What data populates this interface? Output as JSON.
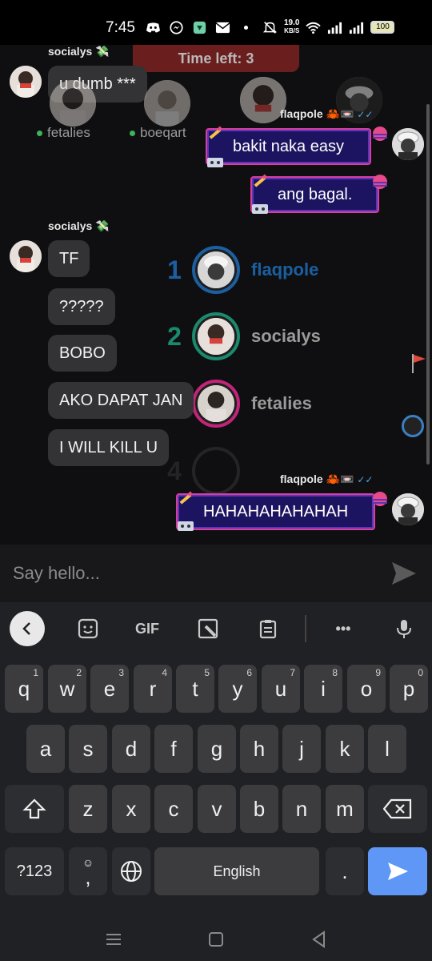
{
  "status_bar": {
    "time": "7:45",
    "net_speed_value": "19.0",
    "net_speed_unit": "KB/S",
    "battery": "100",
    "icons": [
      "discord-icon",
      "messenger-icon",
      "app-icon",
      "mail-icon",
      "dot-icon",
      "mute-icon",
      "wifi-icon",
      "signal-icon",
      "signal-icon-2",
      "battery-icon"
    ]
  },
  "chat": {
    "timer_text": "Time left: 3",
    "messages": [
      {
        "sender": "socialys 💸",
        "text": "u dumb ***"
      },
      {
        "sender": "flaqpole 🦀📼",
        "text": "bakit naka easy"
      },
      {
        "text": "ang bagal."
      },
      {
        "sender": "socialys 💸",
        "text": "TF"
      },
      {
        "text": "?????"
      },
      {
        "text": "BOBO"
      },
      {
        "text": "AKO DAPAT JAN"
      },
      {
        "text": "I WILL KILL U"
      },
      {
        "sender": "flaqpole 🦀📼",
        "text": "HAHAHAHAHAHAH"
      }
    ],
    "online_players": [
      {
        "name": "fetalies"
      },
      {
        "name": "boeqart"
      }
    ],
    "leaderboard": [
      {
        "rank": "1",
        "name": "flaqpole",
        "color": "#1b5fa0"
      },
      {
        "rank": "2",
        "name": "socialys",
        "color": "#1a8a6e"
      },
      {
        "rank": "",
        "name": "fetalies",
        "color": "#c2247a"
      },
      {
        "rank": "4",
        "name": "",
        "color": "#3a3a3a"
      }
    ]
  },
  "input": {
    "placeholder": "Say hello..."
  },
  "keyboard": {
    "toolbar": [
      "back-icon",
      "sticker-icon",
      "GIF",
      "clipboard-image-icon",
      "clipboard-icon",
      "more-icon",
      "mic-icon"
    ],
    "gif_label": "GIF",
    "more_label": "•••",
    "row1": [
      {
        "k": "q",
        "h": "1"
      },
      {
        "k": "w",
        "h": "2"
      },
      {
        "k": "e",
        "h": "3"
      },
      {
        "k": "r",
        "h": "4"
      },
      {
        "k": "t",
        "h": "5"
      },
      {
        "k": "y",
        "h": "6"
      },
      {
        "k": "u",
        "h": "7"
      },
      {
        "k": "i",
        "h": "8"
      },
      {
        "k": "o",
        "h": "9"
      },
      {
        "k": "p",
        "h": "0"
      }
    ],
    "row2": [
      "a",
      "s",
      "d",
      "f",
      "g",
      "h",
      "j",
      "k",
      "l"
    ],
    "row3": [
      "z",
      "x",
      "c",
      "v",
      "b",
      "n",
      "m"
    ],
    "symbols_label": "?123",
    "comma_label": ",",
    "emoji_hint": "☺",
    "space_label": "English",
    "period_label": "."
  },
  "colors": {
    "accent_blue": "#5e97f6",
    "timer_bg": "#6b1e1e",
    "bubble_bg": "#333336",
    "styled_border": "#d63ea0"
  }
}
